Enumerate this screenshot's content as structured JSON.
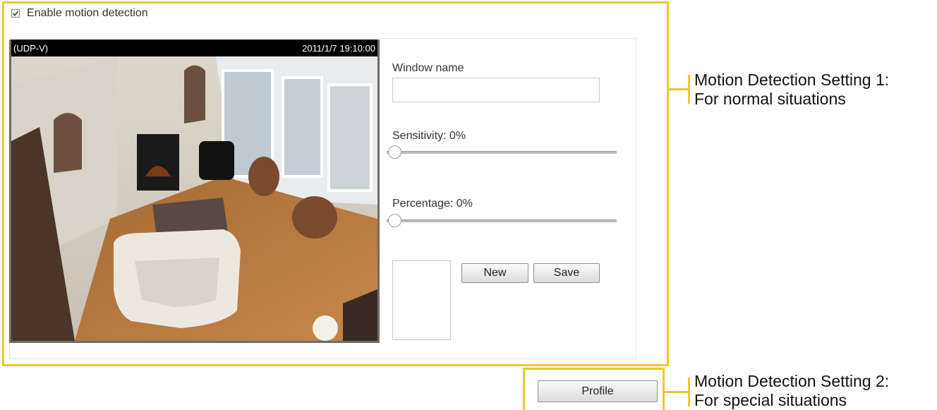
{
  "enable": {
    "label": "Enable motion detection",
    "checked": true
  },
  "video": {
    "stream_label": "(UDP-V)",
    "timestamp": "2011/1/7 19:10:00"
  },
  "window_name": {
    "label": "Window name",
    "value": ""
  },
  "sensitivity": {
    "label": "Sensitivity: 0%",
    "value": 0
  },
  "percentage": {
    "label": "Percentage: 0%",
    "value": 0
  },
  "buttons": {
    "new": "New",
    "save": "Save",
    "profile": "Profile"
  },
  "annotations": {
    "setting1_line1": "Motion Detection Setting 1:",
    "setting1_line2": "For normal situations",
    "setting2_line1": "Motion Detection Setting 2:",
    "setting2_line2": "For special situations"
  },
  "colors": {
    "highlight": "#f0c62e"
  }
}
